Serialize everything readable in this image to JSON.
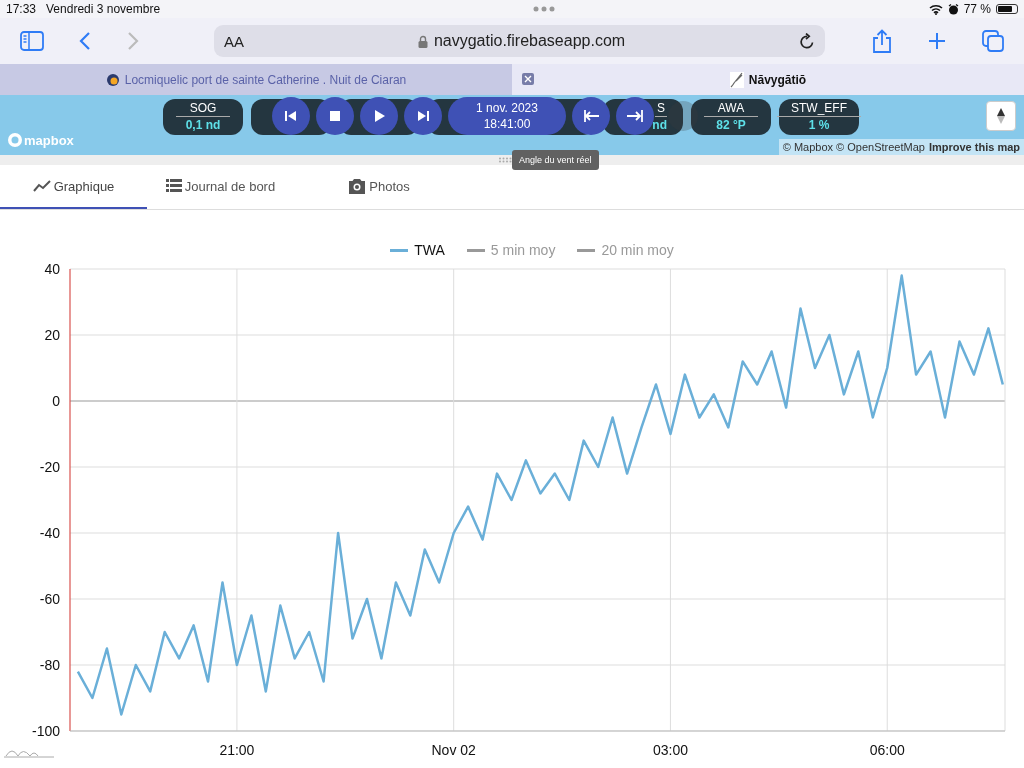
{
  "status_bar": {
    "time": "17:33",
    "date": "Vendredi 3 novembre",
    "battery": "77 %"
  },
  "toolbar": {
    "text_size": "AA",
    "url": "navygatio.firebaseapp.com"
  },
  "browser_tabs": [
    {
      "title": "Locmiquelic port de sainte Catherine . Nuit de Ciaran",
      "selected": false
    },
    {
      "title": "Nāvygātiō",
      "selected": true
    }
  ],
  "map": {
    "logo": "mapbox",
    "instruments": [
      {
        "label": "SOG",
        "value": "0,1 nd",
        "kind": "full"
      },
      {
        "label": "S",
        "value": "nd",
        "kind": "partial"
      },
      {
        "label": "AWA",
        "value": "82 °P",
        "kind": "full"
      },
      {
        "label": "STW_EFF",
        "value": "1 %",
        "kind": "full"
      }
    ],
    "playback": {
      "date": "1 nov. 2023",
      "time": "18:41:00"
    },
    "attribution": "© Mapbox © OpenStreetMap",
    "improve_link": "Improve this map",
    "tooltip": "Angle du vent réel"
  },
  "app_tabs": [
    {
      "label": "Graphique",
      "kind": "chart",
      "selected": true
    },
    {
      "label": "Journal de bord",
      "kind": "list",
      "selected": false
    },
    {
      "label": "Photos",
      "kind": "camera",
      "selected": false
    }
  ],
  "chart": {
    "legend": [
      {
        "label": "5 min moy",
        "active": false
      },
      {
        "label": "20 min moy",
        "active": false
      }
    ],
    "chart_data": {
      "type": "line",
      "categories": [
        null,
        null,
        null,
        null,
        null,
        null,
        null,
        null,
        null,
        null,
        null,
        "21:00",
        null,
        null,
        null,
        null,
        null,
        null,
        null,
        null,
        null,
        null,
        null,
        null,
        null,
        null,
        "Nov 02",
        null,
        null,
        null,
        null,
        null,
        null,
        null,
        null,
        null,
        null,
        null,
        null,
        null,
        null,
        "03:00",
        null,
        null,
        null,
        null,
        null,
        null,
        null,
        null,
        null,
        null,
        null,
        null,
        null,
        null,
        "06:00",
        null,
        null,
        null,
        null,
        null,
        null,
        null,
        null
      ],
      "series": [
        {
          "name": "TWA",
          "color": "#6aafd8",
          "values": [
            -82,
            -90,
            -75,
            -95,
            -80,
            -88,
            -70,
            -78,
            -68,
            -85,
            -55,
            -80,
            -65,
            -88,
            -62,
            -78,
            -70,
            -85,
            -40,
            -72,
            -60,
            -78,
            -55,
            -65,
            -45,
            -55,
            -40,
            -32,
            -42,
            -22,
            -30,
            -18,
            -28,
            -22,
            -30,
            -12,
            -20,
            -5,
            -22,
            -8,
            5,
            -10,
            8,
            -5,
            2,
            -8,
            12,
            5,
            15,
            -2,
            28,
            10,
            20,
            2,
            15,
            -5,
            10,
            38,
            8,
            15,
            -5,
            18,
            8,
            22,
            5
          ]
        }
      ],
      "ylim": [
        -100,
        40
      ],
      "grid": true,
      "yticks": [
        -100,
        -80,
        -60,
        -40,
        -20,
        0,
        20,
        40
      ]
    }
  }
}
